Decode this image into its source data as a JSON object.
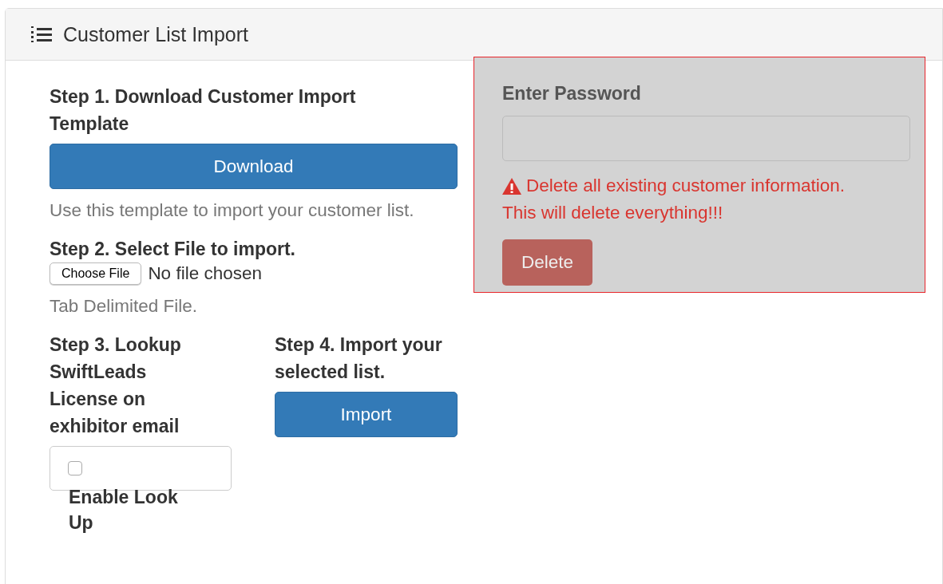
{
  "panel": {
    "title": "Customer List Import"
  },
  "step1": {
    "heading": "Step 1. Download Customer Import Template",
    "button": "Download",
    "help": "Use this template to import your customer list."
  },
  "step2": {
    "heading": "Step 2. Select File to import.",
    "file_button": "Choose File",
    "file_status": "No file chosen",
    "help": "Tab Delimited File."
  },
  "step3": {
    "heading": "Step 3. Lookup SwiftLeads License on exhibitor email",
    "checkbox": {
      "label": "Enable Look Up",
      "checked": false
    }
  },
  "step4": {
    "heading": "Step 4. Import your selected list.",
    "button": "Import"
  },
  "danger": {
    "label": "Enter Password",
    "warning_lines": [
      "Delete all existing customer information.",
      "This will delete everything!!!"
    ],
    "button": {
      "label": "Delete",
      "disabled": true
    }
  }
}
